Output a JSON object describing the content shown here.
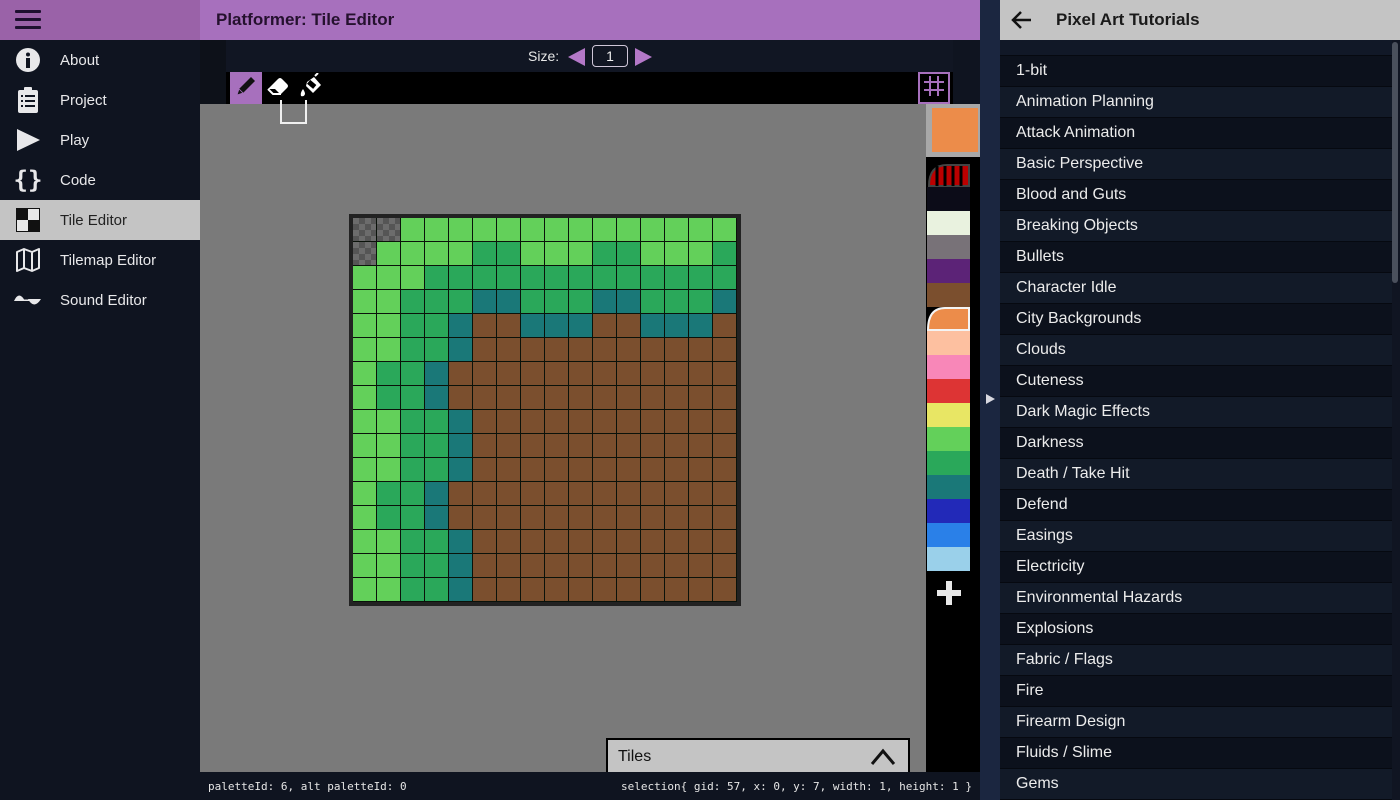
{
  "sidebar": {
    "items": [
      {
        "label": "About",
        "icon": "info-icon",
        "active": false
      },
      {
        "label": "Project",
        "icon": "clipboard-icon",
        "active": false
      },
      {
        "label": "Play",
        "icon": "play-icon",
        "active": false
      },
      {
        "label": "Code",
        "icon": "braces-icon",
        "active": false
      },
      {
        "label": "Tile Editor",
        "icon": "tile-icon",
        "active": true
      },
      {
        "label": "Tilemap Editor",
        "icon": "map-icon",
        "active": false
      },
      {
        "label": "Sound Editor",
        "icon": "wave-icon",
        "active": false
      }
    ]
  },
  "header": {
    "title": "Platformer: Tile Editor"
  },
  "size_control": {
    "label": "Size:",
    "value": "1"
  },
  "tools": [
    {
      "name": "pencil",
      "active": true
    },
    {
      "name": "eraser",
      "active": false
    },
    {
      "name": "fill",
      "active": false
    }
  ],
  "colors": {
    "T": "transparent",
    "L": "#63d05a",
    "G": "#2aa85a",
    "B": "#1a7878",
    "D": "#7b4f2e",
    "accent": "#a770bd"
  },
  "tile": {
    "rows": [
      "TTLLLLLLLLLLLLLL",
      "TLLLLGGLLLGGLLLG",
      "LLLGGGGGGGGGGGGG",
      "LLGGGBBGGGBBGGGB",
      "LLGGBDDBBBDDBBBD",
      "LLGGBDDDDDDDDDDD",
      "LGGBDDDDDDDDDDDD",
      "LGGBDDDDDDDDDDDD",
      "LLGGBDDDDDDDDDDD",
      "LLGGBDDDDDDDDDDD",
      "LLGGBDDDDDDDDDDD",
      "LGGBDDDDDDDDDDDD",
      "LGGBDDDDDDDDDDDD",
      "LLGGBDDDDDDDDDDD",
      "LLGGBDDDDDDDDDDD",
      "LLGGBDDDDDDDDDDD"
    ]
  },
  "palette": {
    "selected_color": "#ec8c4a",
    "swatches": [
      "transparent-striped",
      "#0c0c18",
      "#e9f2df",
      "#787278",
      "#5c2377",
      "#7b4f2e",
      "#ec8c4a",
      "#fdc0a0",
      "#f887b8",
      "#dd3434",
      "#e8e664",
      "#63d05a",
      "#2aa85a",
      "#1a7878",
      "#2229b8",
      "#2a80e8",
      "#9ad0ea"
    ],
    "selected_index": 6
  },
  "tiles_panel": {
    "label": "Tiles"
  },
  "status": {
    "left": "paletteId: 6, alt paletteId: 0",
    "right": "selection{ gid: 57, x: 0, y: 7, width: 1, height: 1 }"
  },
  "right_panel": {
    "title": "Pixel Art Tutorials",
    "items": [
      "1-bit",
      "Animation Planning",
      "Attack Animation",
      "Basic Perspective",
      "Blood and Guts",
      "Breaking Objects",
      "Bullets",
      "Character Idle",
      "City Backgrounds",
      "Clouds",
      "Cuteness",
      "Dark Magic Effects",
      "Darkness",
      "Death / Take Hit",
      "Defend",
      "Easings",
      "Electricity",
      "Environmental Hazards",
      "Explosions",
      "Fabric / Flags",
      "Fire",
      "Firearm Design",
      "Fluids / Slime",
      "Gems"
    ]
  }
}
